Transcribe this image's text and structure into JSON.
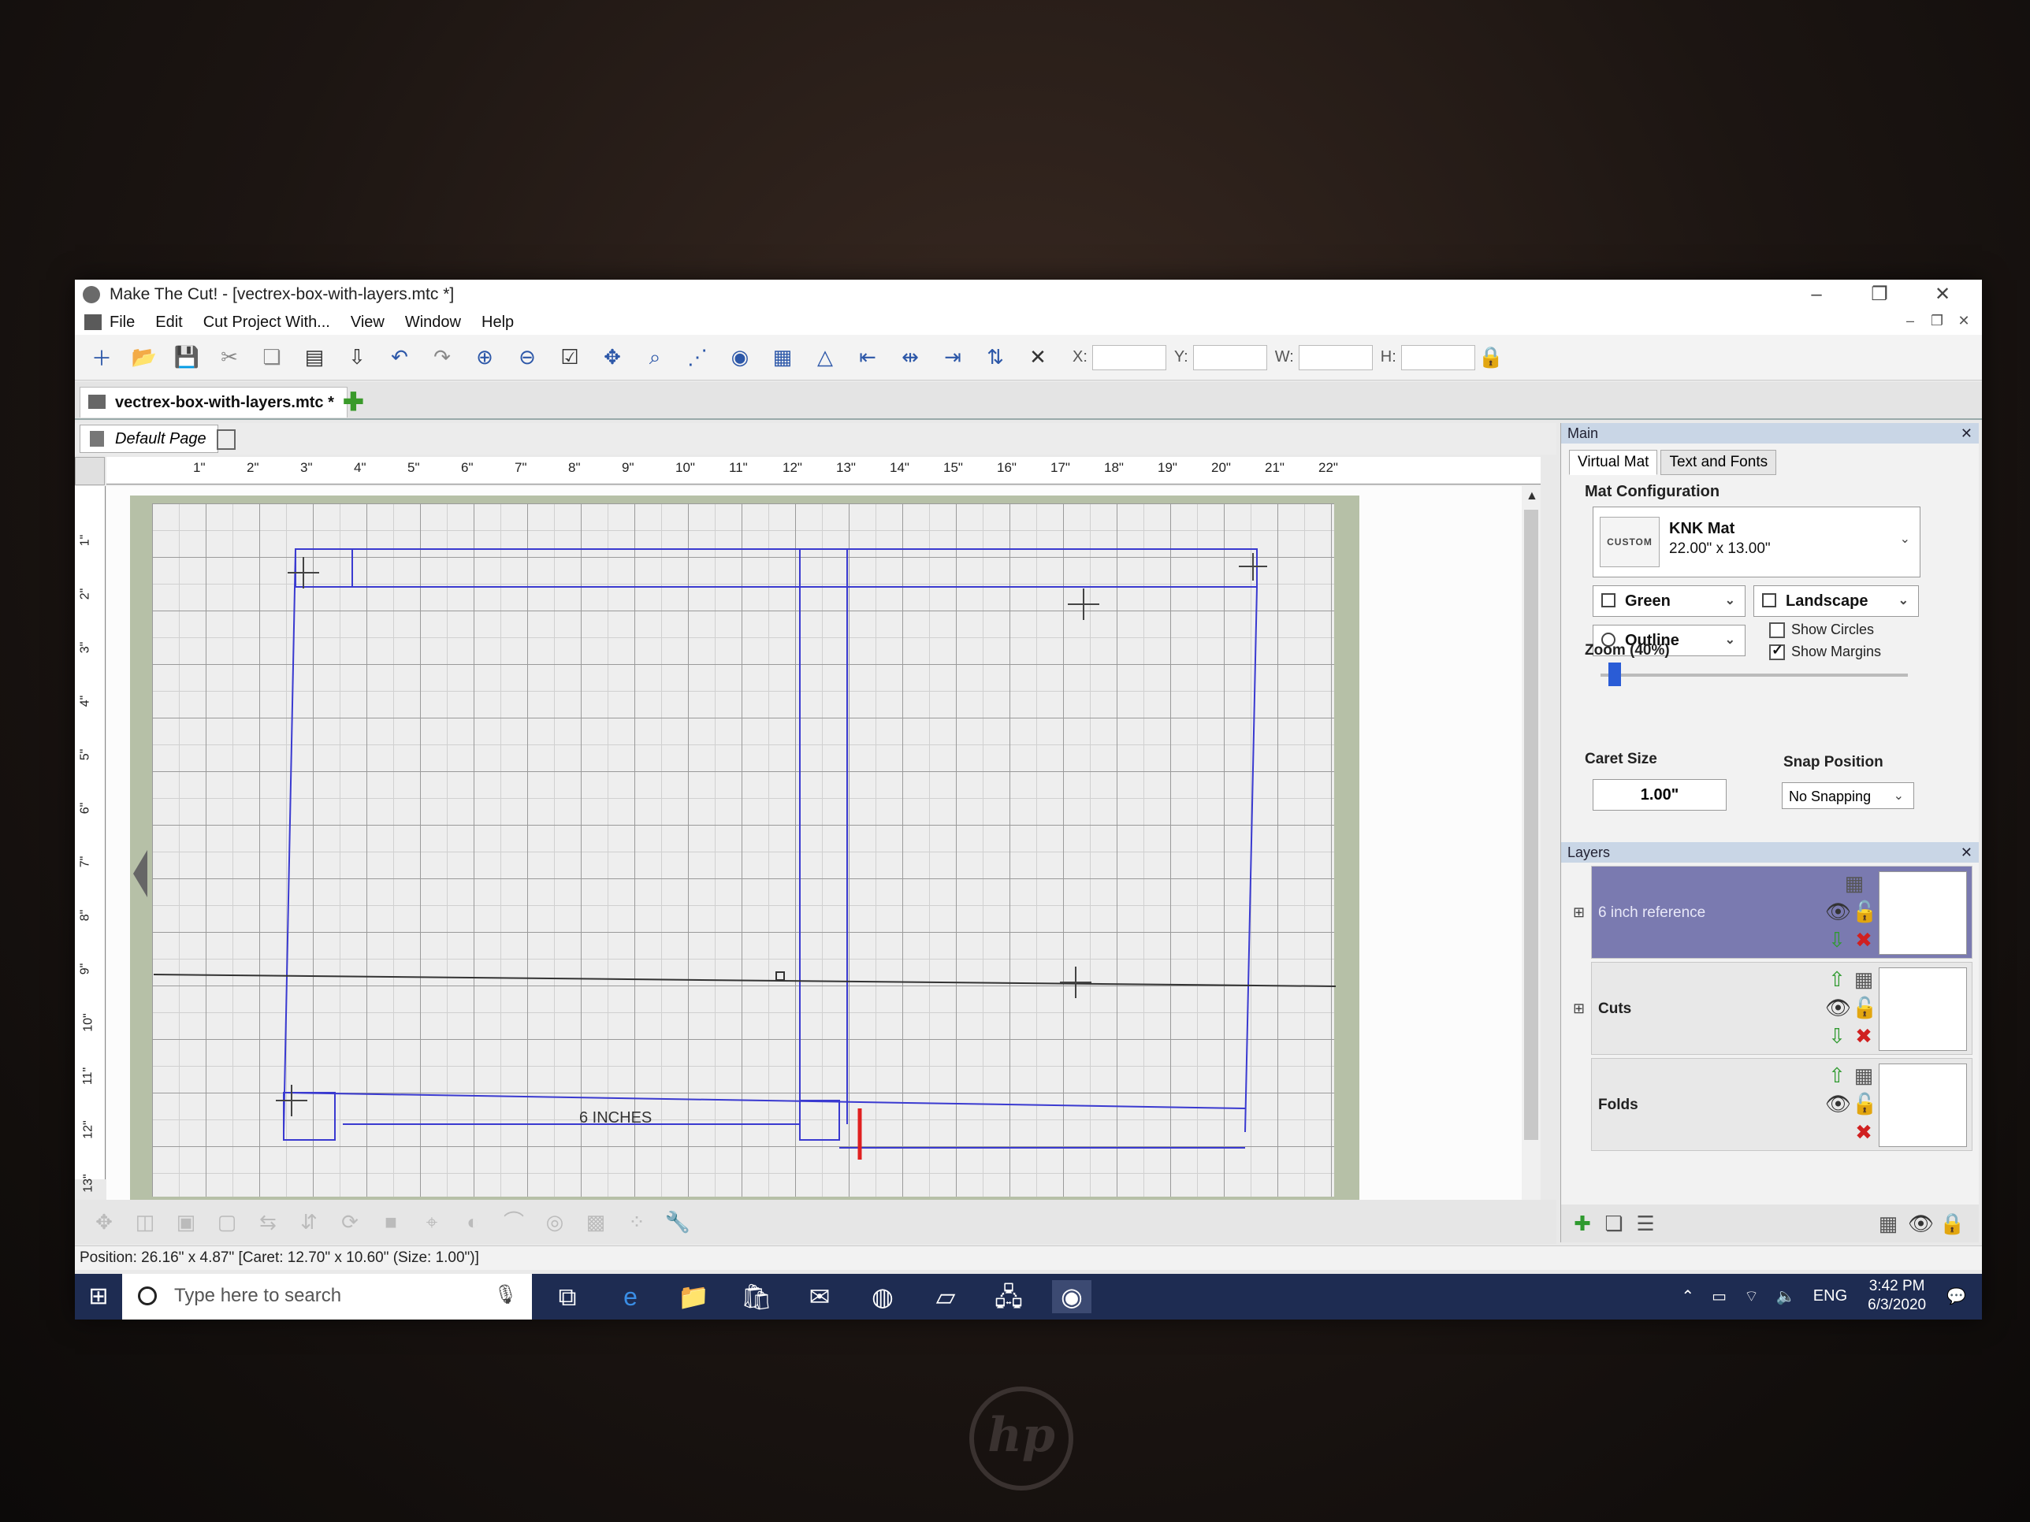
{
  "window": {
    "title": "Make The Cut! - [vectrex-box-with-layers.mtc *]",
    "controls": [
      "–",
      "❐",
      "✕"
    ]
  },
  "menu": [
    "File",
    "Edit",
    "Cut Project With...",
    "View",
    "Window",
    "Help"
  ],
  "toolbar": {
    "coords": {
      "x_label": "X:",
      "y_label": "Y:",
      "w_label": "W:",
      "h_label": "H:"
    }
  },
  "doc_tab": {
    "label": "vectrex-box-with-layers.mtc *"
  },
  "page_tab": {
    "label": "Default Page"
  },
  "ruler": {
    "h_marks": [
      "1\"",
      "2\"",
      "3\"",
      "4\"",
      "5\"",
      "6\"",
      "7\"",
      "8\"",
      "9\"",
      "10\"",
      "11\"",
      "12\"",
      "13\"",
      "14\"",
      "15\"",
      "16\"",
      "17\"",
      "18\"",
      "19\"",
      "20\"",
      "21\"",
      "22\""
    ],
    "v_marks": [
      "1\"",
      "2\"",
      "3\"",
      "4\"",
      "5\"",
      "6\"",
      "7\"",
      "8\"",
      "9\"",
      "10\"",
      "11\"",
      "12\"",
      "13\""
    ]
  },
  "canvas": {
    "text_label": "6 INCHES"
  },
  "status": {
    "text": "Position: 26.16\" x 4.87\" [Caret: 12.70\" x 10.60\" (Size: 1.00\")]"
  },
  "panel": {
    "title": "Main",
    "tabs": [
      "Virtual Mat",
      "Text and Fonts"
    ],
    "mat_config": {
      "group": "Mat Configuration",
      "badge": "CUSTOM",
      "name": "KNK Mat",
      "size": "22.00\" x 13.00\"",
      "color": "Green",
      "orientation": "Landscape",
      "style": "Outline",
      "show_circles": {
        "label": "Show Circles",
        "checked": false
      },
      "show_margins": {
        "label": "Show Margins",
        "checked": true
      }
    },
    "zoom": {
      "label": "Zoom (40%)",
      "value": 0.4
    },
    "caret": {
      "label": "Caret Size",
      "value": "1.00\""
    },
    "snap": {
      "label": "Snap Position",
      "value": "No Snapping"
    }
  },
  "layers": {
    "title": "Layers",
    "items": [
      {
        "name": "6 inch reference",
        "selected": true
      },
      {
        "name": "Cuts",
        "selected": false
      },
      {
        "name": "Folds",
        "selected": false
      }
    ]
  },
  "taskbar": {
    "search_placeholder": "Type here to search",
    "lang": "ENG",
    "time": "3:42 PM",
    "date": "6/3/2020"
  },
  "colors": {
    "accent": "#2a5cd6",
    "layer_selected": "#7a7ab0",
    "mat_green": "#b6c0a7",
    "cut_line": "#3a3ad0",
    "caret": "#e02020"
  }
}
